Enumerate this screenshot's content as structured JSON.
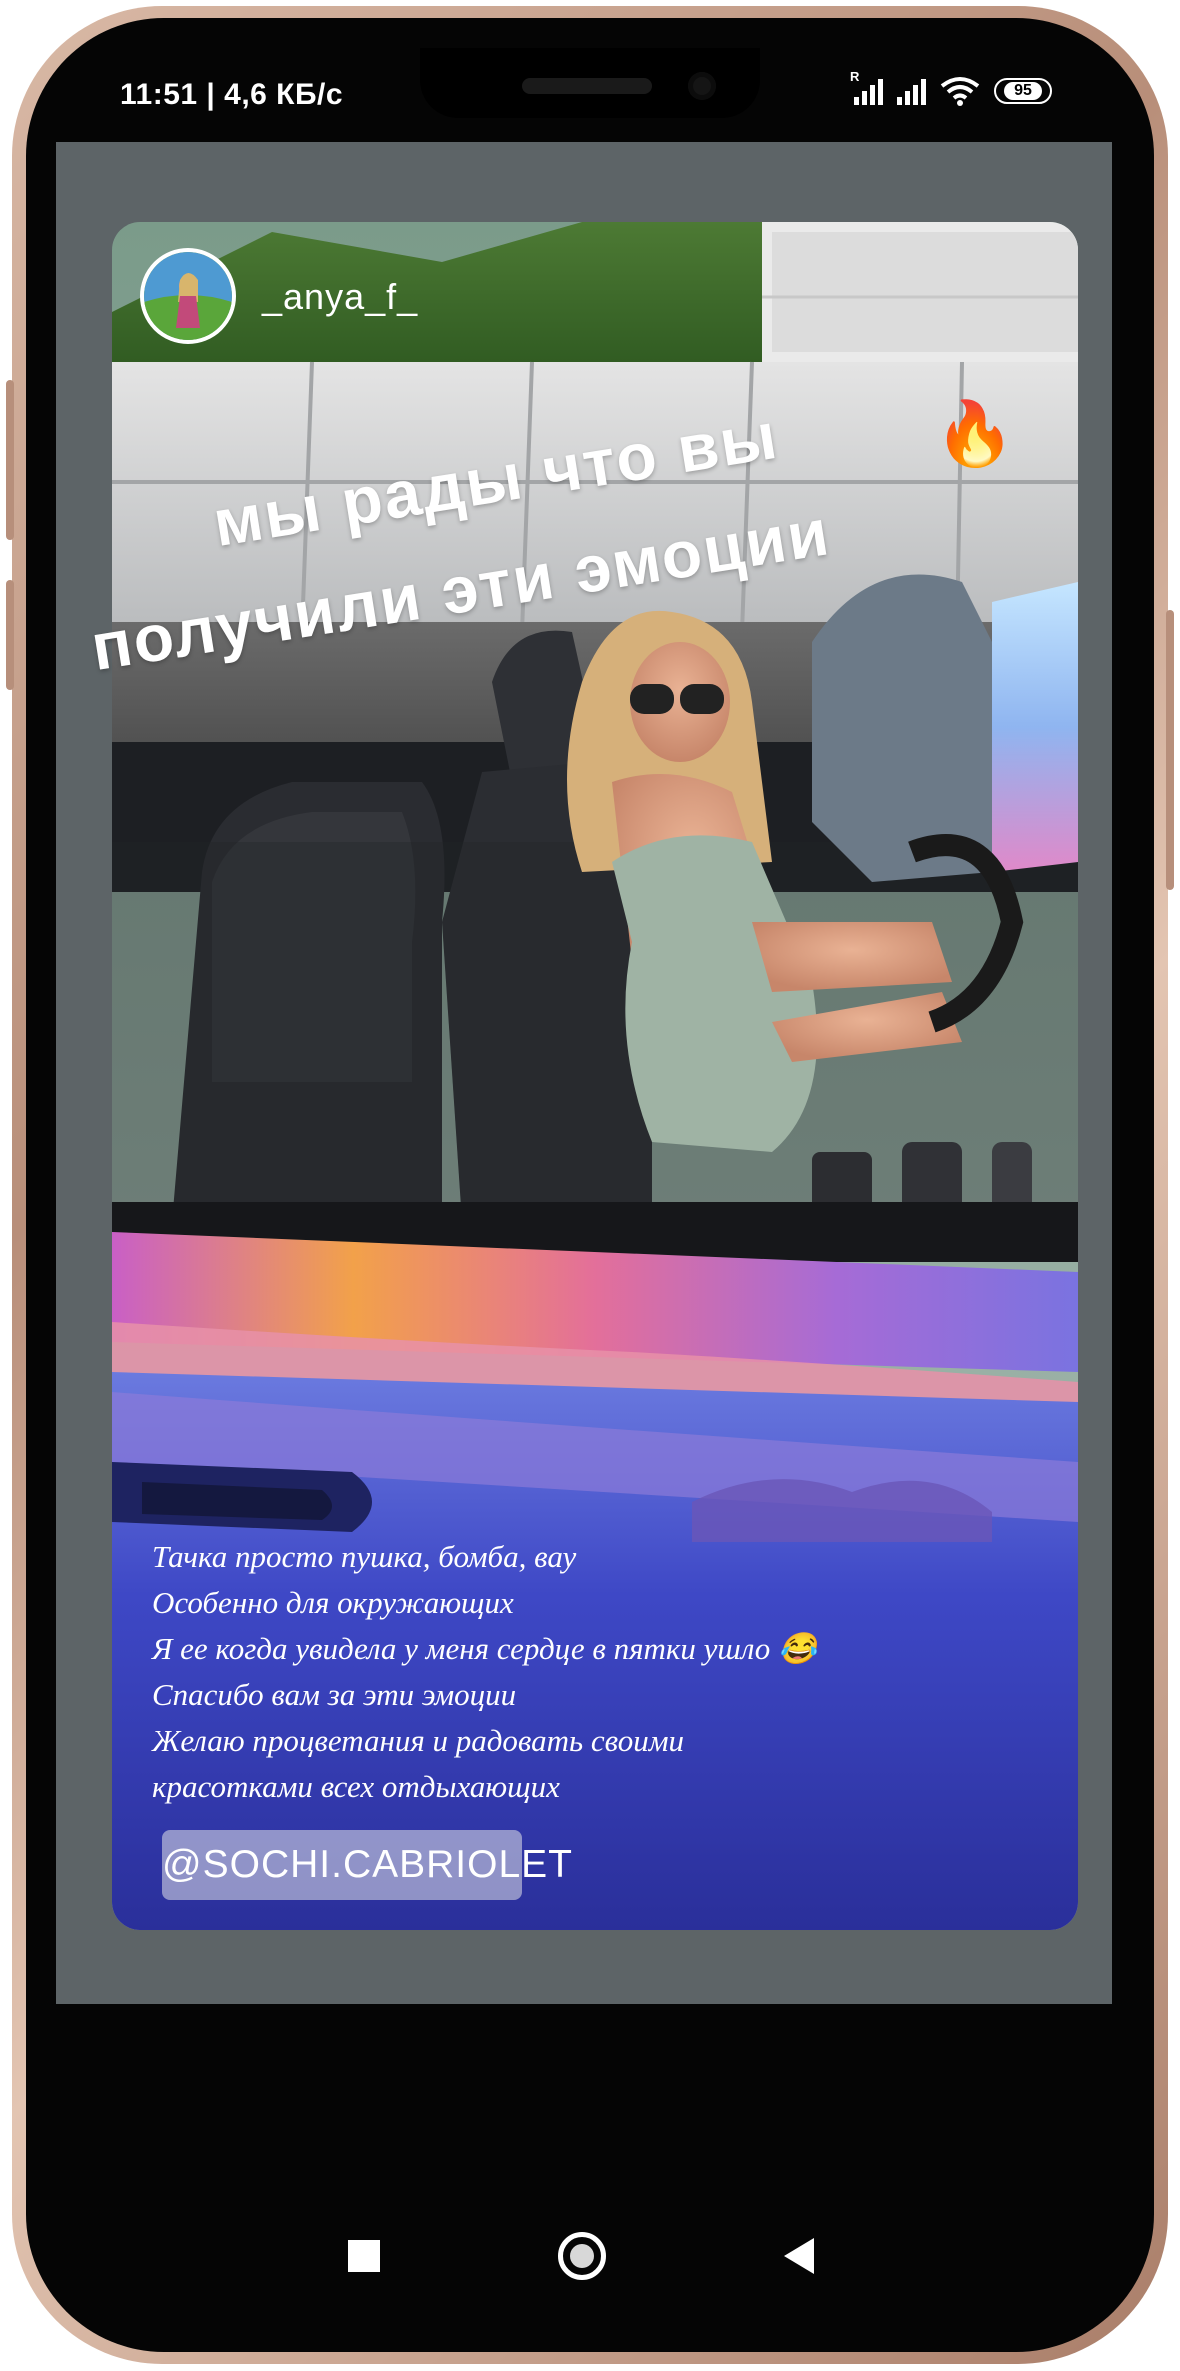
{
  "status_bar": {
    "time": "11:51 | 4,6 КБ/с",
    "battery": "95",
    "signal_label": "R"
  },
  "story": {
    "username": "_anya_f_",
    "caption_line1": "мы рады что вы",
    "caption_line2": "получили эти эмоции",
    "caption_emoji": "🔥",
    "review_lines": [
      "Тачка просто пушка, бомба, вау",
      "Особенно для окружающих",
      "Я ее когда увидела у меня сердце в пятки ушло 😂",
      "Спасибо вам за эти эмоции",
      "Желаю процветания и радовать своими",
      "красотками всех отдыхающих"
    ],
    "mention_tag": "@SOCHI.CABRIOLET"
  },
  "nav": {
    "recents_icon": "square-icon",
    "home_icon": "circle-icon",
    "back_icon": "triangle-back-icon"
  }
}
